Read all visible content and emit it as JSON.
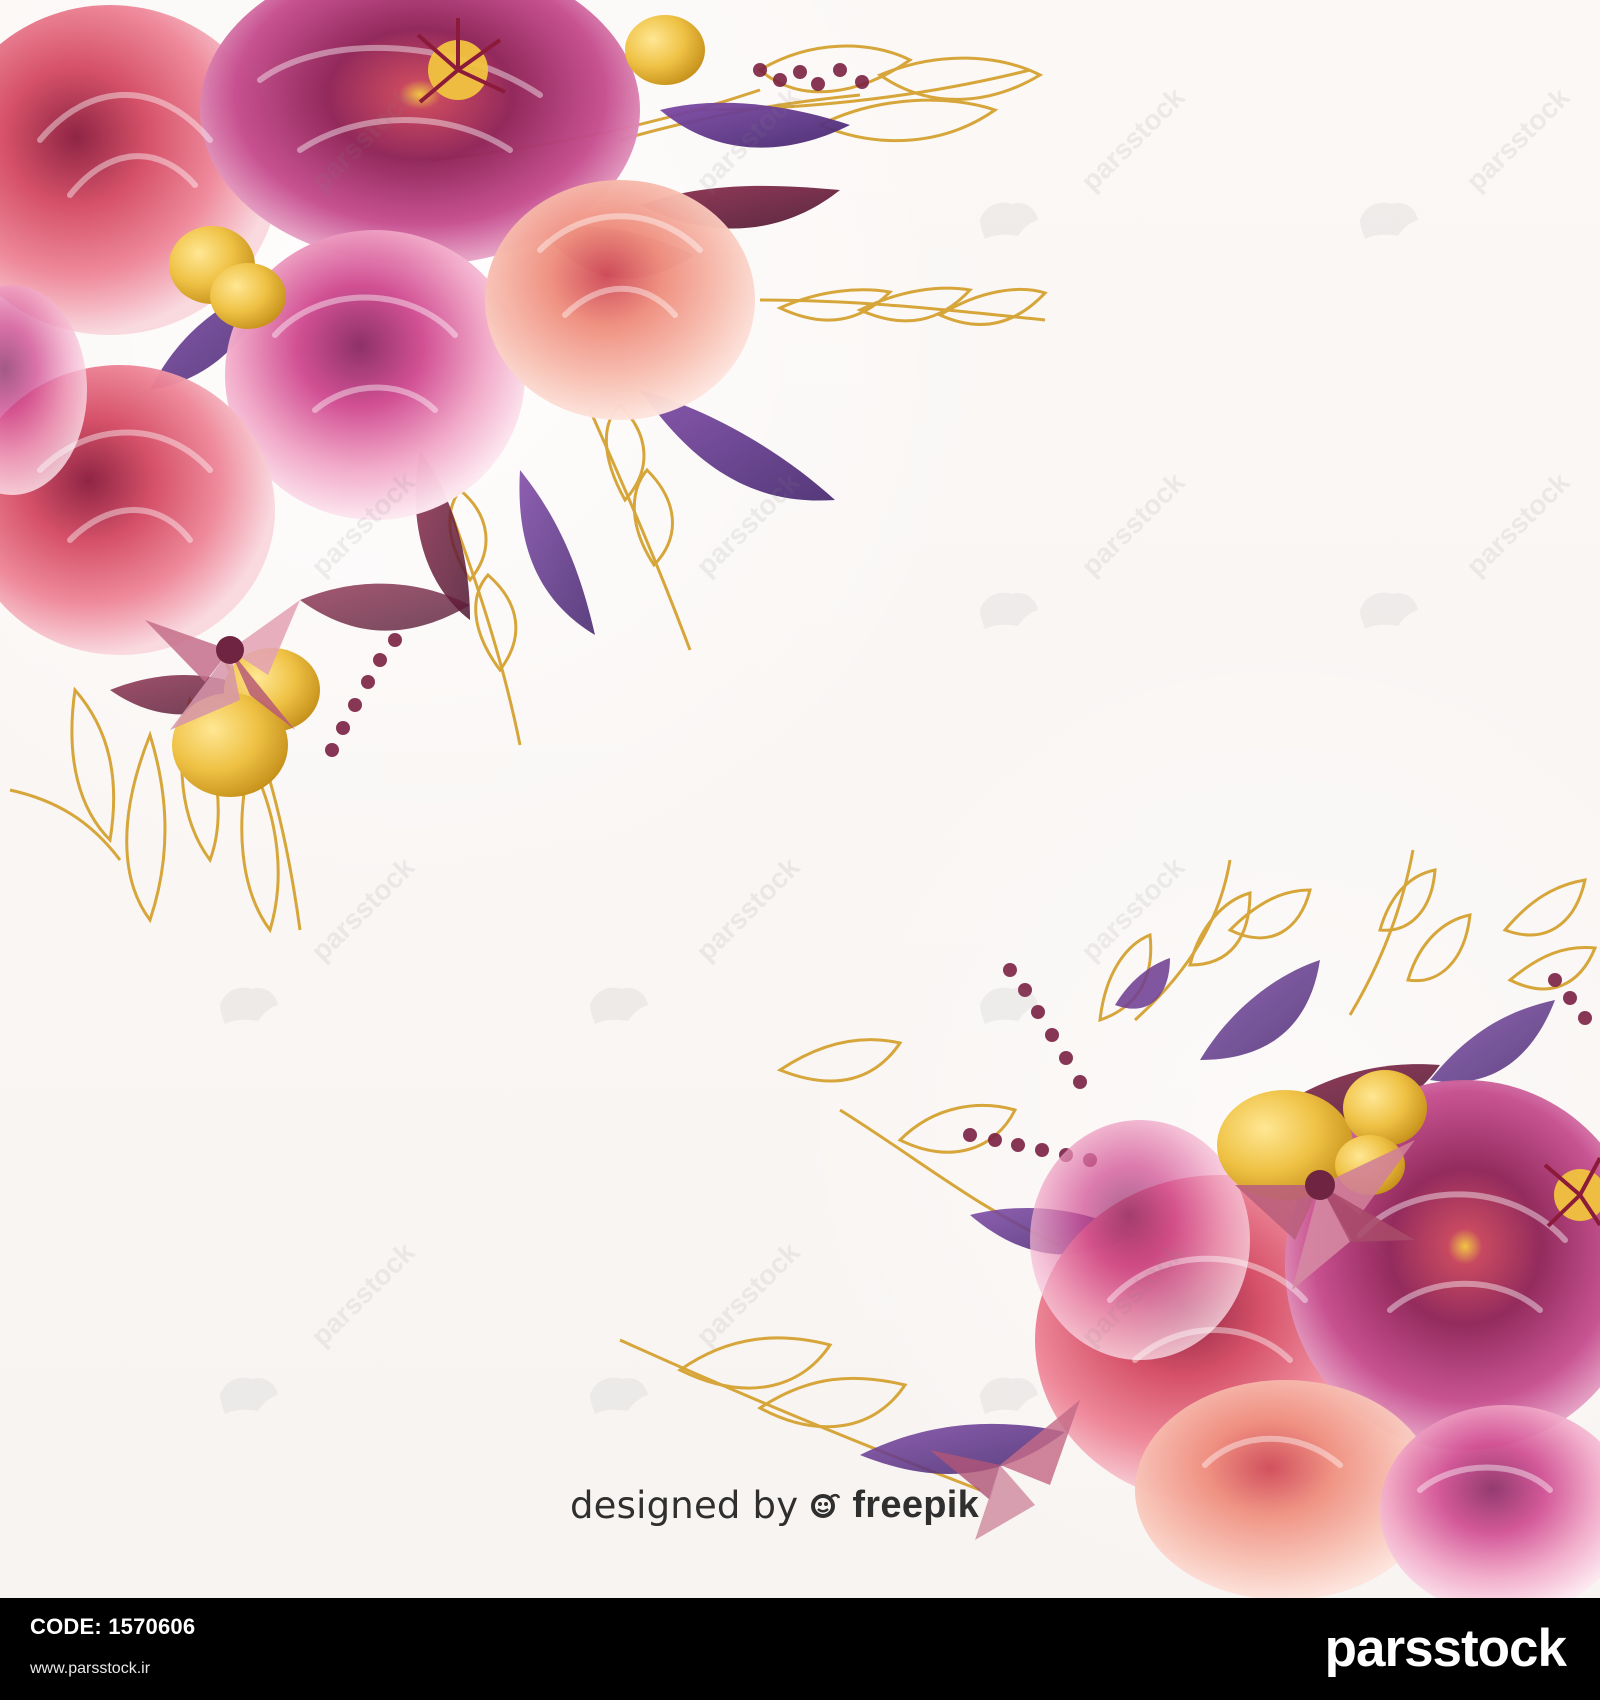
{
  "credit": {
    "prefix": "designed by",
    "brand": "freepik"
  },
  "footer": {
    "code_label": "CODE:",
    "code_value": "1570606",
    "url": "www.parsstock.ir",
    "logo_text": "parsstock"
  },
  "watermarks": {
    "text": "parsstock"
  },
  "icons": {
    "freepik_logo": "freepik-logo-icon",
    "flower_corner": "watercolor-floral-bouquet-icon",
    "flower_bottom_right": "watercolor-floral-bouquet-icon"
  },
  "colors": {
    "footer_bg": "#000000",
    "footer_text": "#ffffff",
    "canvas_bg": "#faf7f5",
    "rose_red": "#d74b62",
    "rose_pink": "#e98ea9",
    "peony_magenta": "#a72b6b",
    "gold_line": "#d7a63a",
    "yellow_berry": "#e9bc38",
    "purple_leaf": "#6f3f93",
    "burgundy": "#7b2143",
    "coral": "#ef8f7e"
  }
}
